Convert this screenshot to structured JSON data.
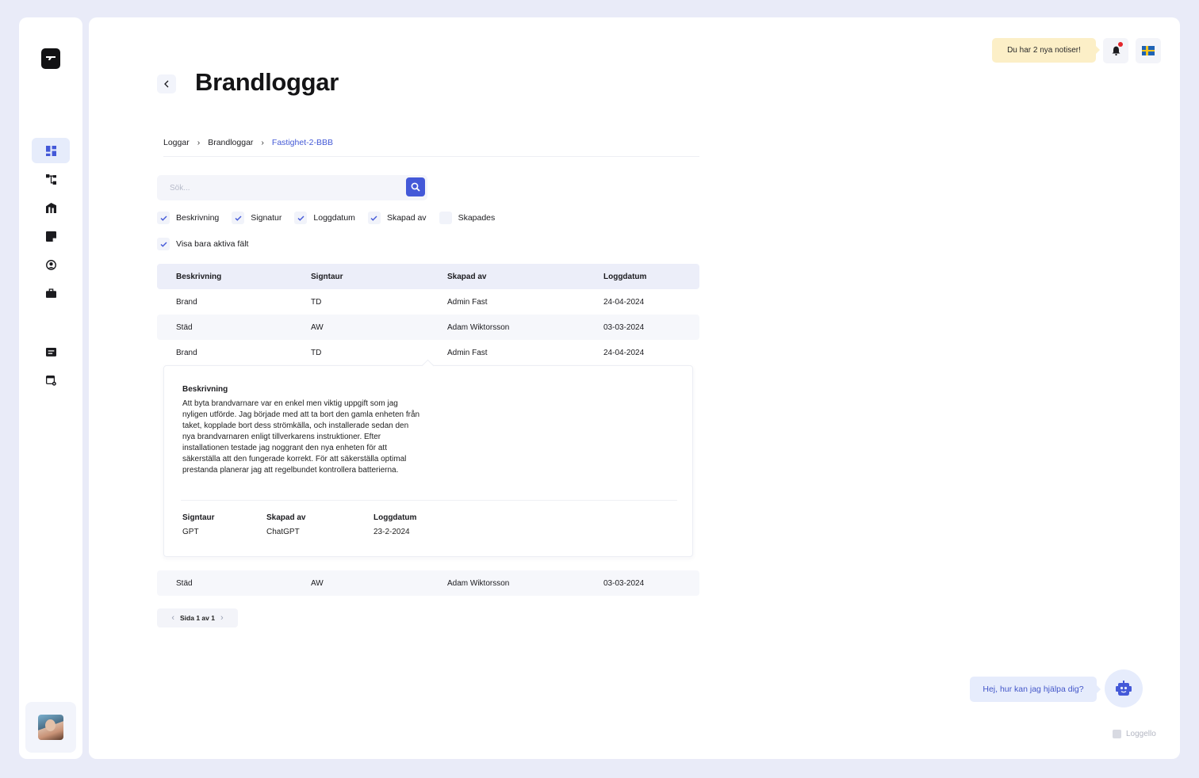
{
  "app": {
    "brand": "Loggello"
  },
  "sidebar": {
    "items": [
      {
        "icon": "dashboard-icon",
        "active": true
      },
      {
        "icon": "hierarchy-icon",
        "active": false
      },
      {
        "icon": "buildings-icon",
        "active": false
      },
      {
        "icon": "note-icon",
        "active": false
      },
      {
        "icon": "user-circle-icon",
        "active": false
      },
      {
        "icon": "briefcase-icon",
        "active": false
      },
      {
        "icon": "messages-icon",
        "active": false
      },
      {
        "icon": "settings-window-icon",
        "active": false
      }
    ]
  },
  "header": {
    "title": "Brandloggar",
    "notice": "Du har 2 nya notiser!"
  },
  "breadcrumb": {
    "items": [
      "Loggar",
      "Brandloggar"
    ],
    "current": "Fastighet-2-BBB",
    "separator": "›"
  },
  "search": {
    "placeholder": "Sök..."
  },
  "filters": {
    "columns": [
      {
        "label": "Beskrivning",
        "checked": true
      },
      {
        "label": "Signatur",
        "checked": true
      },
      {
        "label": "Loggdatum",
        "checked": true
      },
      {
        "label": "Skapad av",
        "checked": true
      },
      {
        "label": "Skapades",
        "checked": false
      }
    ],
    "active_only": {
      "label": "Visa bara aktiva fält",
      "checked": true
    }
  },
  "table": {
    "headers": [
      "Beskrivning",
      "Signtaur",
      "Skapad av",
      "Loggdatum"
    ],
    "rows": [
      [
        "Brand",
        "TD",
        "Admin Fast",
        "24-04-2024"
      ],
      [
        "Städ",
        "AW",
        "Adam Wiktorsson",
        "03-03-2024"
      ],
      [
        "Brand",
        "TD",
        "Admin Fast",
        "24-04-2024"
      ],
      [
        "Städ",
        "AW",
        "Adam Wiktorsson",
        "03-03-2024"
      ]
    ]
  },
  "detail": {
    "description_label": "Beskrivning",
    "description": "Att byta brandvarnare var en enkel men viktig uppgift som jag nyligen utförde. Jag började med att ta bort den gamla enheten från taket, kopplade bort dess strömkälla, och installerade sedan den nya brandvarnaren enligt tillverkarens instruktioner. Efter installationen testade jag noggrant den nya enheten för att säkerställa att den fungerade korrekt. För att säkerställa optimal prestanda planerar jag att regelbundet kontrollera batterierna.",
    "signature_label": "Signtaur",
    "signature": "GPT",
    "created_by_label": "Skapad av",
    "created_by": "ChatGPT",
    "date_label": "Loggdatum",
    "date": "23-2-2024"
  },
  "pagination": {
    "label": "Sida 1 av 1"
  },
  "chat": {
    "prompt": "Hej, hur kan jag hjälpa dig?"
  },
  "colors": {
    "accent": "#4459d8",
    "page_bg": "#e9ebf8",
    "notice_bg": "#fcefc7",
    "notification_dot": "#e3262b"
  }
}
